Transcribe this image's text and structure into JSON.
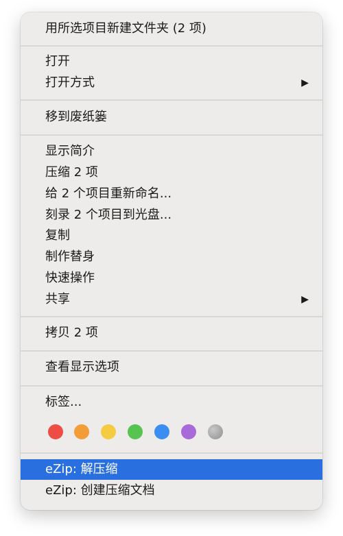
{
  "menu": {
    "new_folder": "用所选项目新建文件夹 (2 项)",
    "open": "打开",
    "open_with": "打开方式",
    "move_to_trash": "移到废纸篓",
    "get_info": "显示简介",
    "compress": "压缩 2 项",
    "rename": "给 2 个项目重新命名...",
    "burn": "刻录 2 个项目到光盘...",
    "duplicate": "复制",
    "make_alias": "制作替身",
    "quick_actions": "快速操作",
    "share": "共享",
    "copy": "拷贝 2 项",
    "view_options": "查看显示选项",
    "tags": "标签...",
    "ezip_extract": "eZip: 解压缩",
    "ezip_create": "eZip: 创建压缩文档"
  },
  "icons": {
    "submenu": "chevron-right-icon",
    "submenu_glyph": "▶"
  },
  "tag_colors": [
    "#ee4d45",
    "#f39c38",
    "#f5cb41",
    "#57c350",
    "#3b8ef1",
    "#a869d9",
    "#a0a0a0"
  ],
  "highlight_color": "#2a6fe0"
}
